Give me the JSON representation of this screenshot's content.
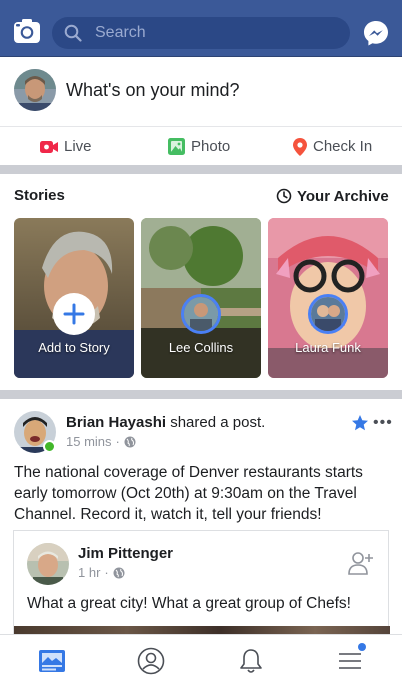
{
  "header": {
    "search_placeholder": "Search"
  },
  "composer": {
    "prompt": "What's on your mind?"
  },
  "actions": {
    "live": "Live",
    "photo": "Photo",
    "check_in": "Check In"
  },
  "stories": {
    "title": "Stories",
    "archive": "Your Archive",
    "items": [
      {
        "label": "Add to Story"
      },
      {
        "label": "Lee Collins"
      },
      {
        "label": "Laura Funk"
      }
    ]
  },
  "post": {
    "author": "Brian Hayashi",
    "action": "shared a post.",
    "time": "15 mins",
    "text": "The national coverage of Denver restaurants starts early tomorrow (Oct 20th) at 9:30am on the Travel Channel. Record it, watch it, tell your friends!",
    "shared": {
      "author": "Jim Pittenger",
      "time": "1 hr",
      "text": "What a great city!  What a great group of Chefs!"
    }
  },
  "colors": {
    "brand": "#3b5998",
    "link_blue": "#4a80f5",
    "online": "#42b72a",
    "live_red": "#f02849",
    "photo_green": "#45bd62",
    "checkin_pink": "#f5533d"
  },
  "icons": [
    "camera-icon",
    "search-icon",
    "messenger-icon",
    "live-video-icon",
    "photo-icon",
    "location-pin-icon",
    "clock-archive-icon",
    "plus-icon",
    "globe-icon",
    "star-icon",
    "more-icon",
    "add-friend-icon",
    "news-feed-icon",
    "profile-icon",
    "bell-icon",
    "menu-icon"
  ]
}
